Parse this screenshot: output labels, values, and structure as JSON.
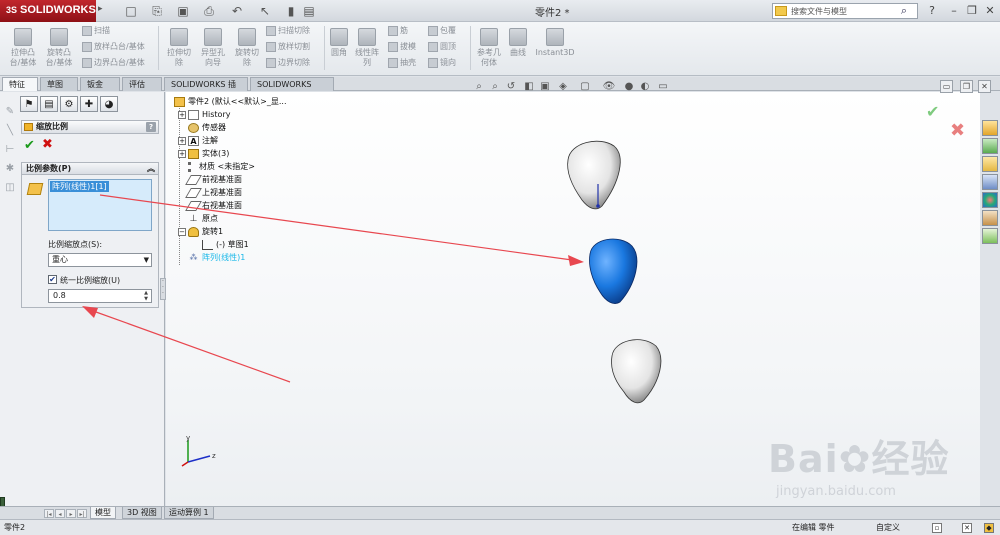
{
  "titlebar": {
    "brand_prefix": "3S",
    "brand": "SOLIDWORKS",
    "doc_title": "零件2 *",
    "search_placeholder": "搜索文件与模型",
    "help": "?"
  },
  "ribbon": {
    "big_buttons": [
      {
        "label": "拉伸凸\n台/基体"
      },
      {
        "label": "旋转凸\n台/基体"
      },
      {
        "label": "拉伸切\n除"
      },
      {
        "label": "异型孔\n向导"
      },
      {
        "label": "旋转切\n除"
      },
      {
        "label": "圆角"
      },
      {
        "label": "线性阵\n列"
      },
      {
        "label": "参考几\n何体"
      },
      {
        "label": "曲线"
      },
      {
        "label": "Instant3D"
      }
    ],
    "small_buttons": {
      "sweep": "扫描",
      "loft": "放样凸台/基体",
      "boundary_boss": "边界凸台/基体",
      "sweep_cut": "扫描切除",
      "loft_cut": "放样切割",
      "boundary_cut": "边界切除",
      "rib": "筋",
      "draft": "拔模",
      "shell": "抽壳",
      "wrap": "包覆",
      "dome": "圆顶",
      "mirror": "镜向"
    }
  },
  "tabs": [
    "特征",
    "草图",
    "钣金",
    "评估",
    "SOLIDWORKS 插件",
    "SOLIDWORKS MBD"
  ],
  "property_manager": {
    "title": "缩放比例",
    "group_title": "比例参数(P)",
    "selection_item": "阵列(线性)1[1]",
    "scale_about_label": "比例缩放点(S):",
    "scale_about_value": "重心",
    "uniform_label": "统一比例缩放(U)",
    "uniform_checked": true,
    "scale_factor": "0.8"
  },
  "tree": {
    "root": "零件2 (默认<<默认>_显...",
    "items": [
      {
        "label": "History"
      },
      {
        "label": "传感器"
      },
      {
        "label": "注解"
      },
      {
        "label": "实体(3)"
      },
      {
        "label": "材质 <未指定>"
      },
      {
        "label": "前视基准面"
      },
      {
        "label": "上视基准面"
      },
      {
        "label": "右视基准面"
      },
      {
        "label": "原点"
      },
      {
        "label": "旋转1"
      },
      {
        "label": "(-) 草图1"
      },
      {
        "label": "阵列(线性)1"
      }
    ]
  },
  "bottom_tabs": [
    "模型",
    "3D 视图",
    "运动算例 1"
  ],
  "status": {
    "left": "零件2",
    "editing": "在编辑 零件",
    "units": "自定义"
  },
  "watermark": {
    "text": "Bai",
    "text2": "经验",
    "url": "jingyan.baidu.com"
  },
  "colors": {
    "selected_body": "#1a78e0",
    "body": "#f4f4f4",
    "arrow": "#e8474f",
    "brand": "#b81f26"
  }
}
